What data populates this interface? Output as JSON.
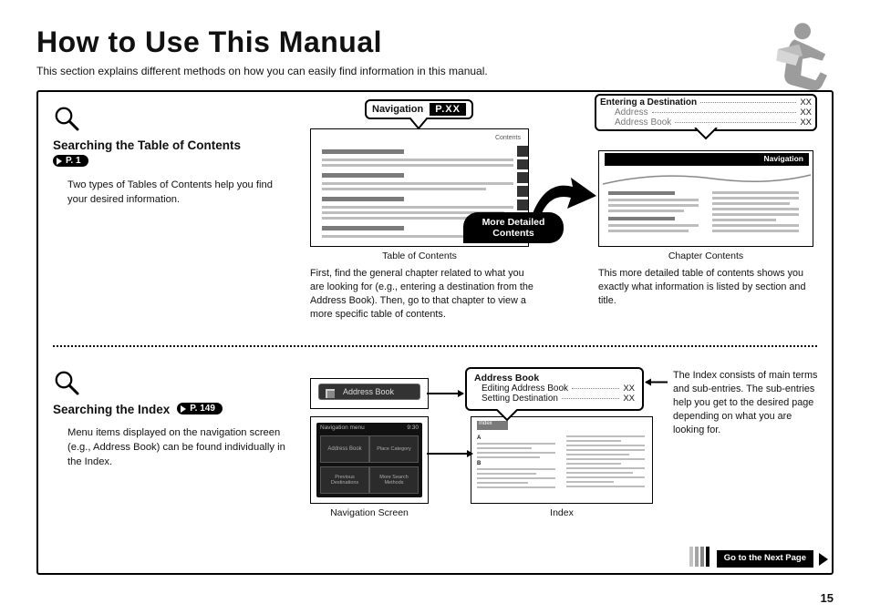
{
  "title": "How to Use This Manual",
  "subtitle": "This section explains different methods on how you can easily find information in this manual.",
  "page_number": "15",
  "section1": {
    "heading": "Searching the Table of Contents",
    "page_ref": "P. 1",
    "body": "Two types of Tables of Contents help you find your desired information.",
    "nav_callout_label": "Navigation",
    "nav_callout_pxx": "P.XX",
    "toc_label": "Table of Contents",
    "chapter_label": "Chapter Contents",
    "more_detailed": "More Detailed Contents",
    "toc_header_text": "Contents",
    "chapter_list": {
      "main": {
        "label": "Entering a Destination",
        "page": "XX"
      },
      "sub1": {
        "label": "Address",
        "page": "XX"
      },
      "sub2": {
        "label": "Address Book",
        "page": "XX"
      }
    },
    "chapter_banner": "Navigation",
    "toc_desc": "First, find the general chapter related to what you are looking for (e.g., entering a destination from the Address Book). Then, go to that chapter to view a more specific table of contents.",
    "chapter_desc": "This more detailed table of contents shows you exactly what information is listed by section and title."
  },
  "section2": {
    "heading": "Searching the Index",
    "page_ref": "P. 149",
    "body": "Menu items displayed on the navigation screen (e.g., Address Book) can be found individually in the Index.",
    "nav_screen_label": "Navigation Screen",
    "nav_menu_title": "Navigation menu",
    "nav_time": "9:30",
    "address_book_btn": "Address Book",
    "btn_prev": "Previous Destinations",
    "btn_place": "Place Category",
    "btn_more": "More Search Methods",
    "index_label": "Index",
    "index_header": "Index",
    "index_callout": {
      "title": "Address Book",
      "row1": {
        "label": "Editing Address Book",
        "page": "XX"
      },
      "row2": {
        "label": "Setting Destination",
        "page": "XX"
      }
    },
    "index_desc": "The Index consists of main terms and sub-entries. The sub-entries help you get to the desired page depending on what you are looking for."
  },
  "goto_label": "Go to the Next Page"
}
